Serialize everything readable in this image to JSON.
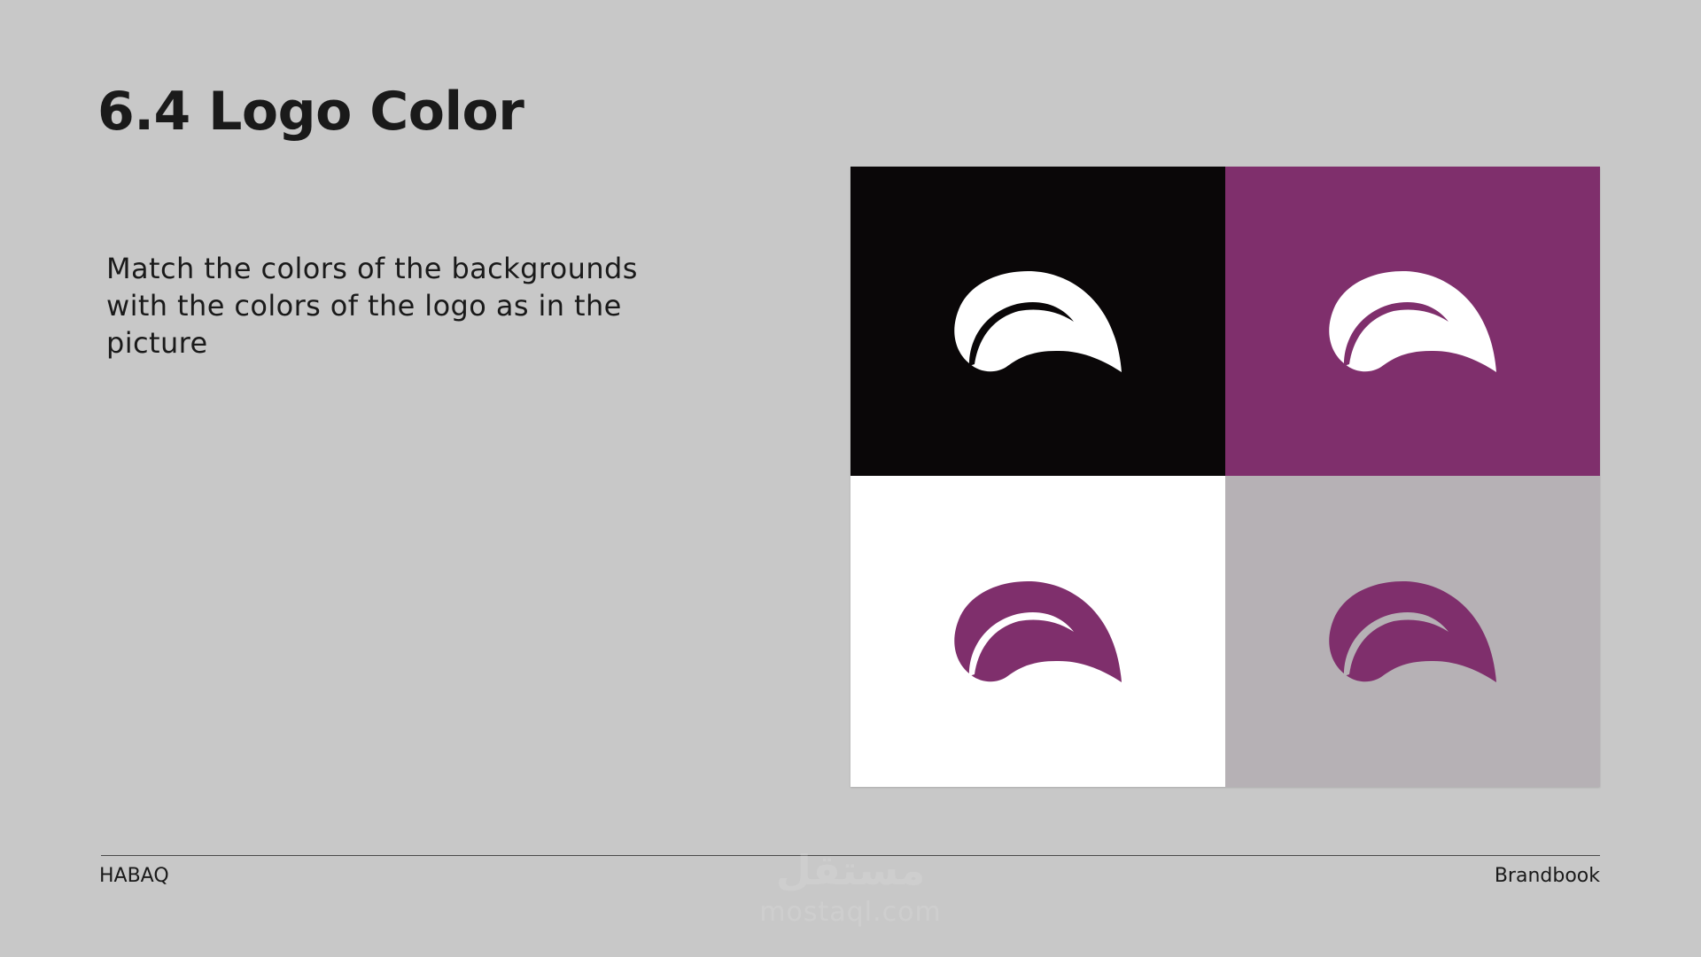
{
  "slide": {
    "title": "6.4 Logo Color",
    "description": "Match the colors of the backgrounds with the colors of the logo as in the picture"
  },
  "logo_variants": [
    {
      "background": "#0a0708",
      "logo_color": "#ffffff",
      "accent_color": "#0a0708"
    },
    {
      "background": "#7f2f6c",
      "logo_color": "#ffffff",
      "accent_color": "#7f2f6c"
    },
    {
      "background": "#ffffff",
      "logo_color": "#7f2f6c",
      "accent_color": "#ffffff"
    },
    {
      "background": "#b6b1b5",
      "logo_color": "#7f2f6c",
      "accent_color": "#b6b1b5"
    }
  ],
  "footer": {
    "left": "HABAQ",
    "right": "Brandbook"
  },
  "watermark": {
    "main": "مستقل",
    "sub": "mostaql.com"
  },
  "colors": {
    "page_background": "#c8c8c8",
    "text": "#1a1a1a",
    "brand_purple": "#7f2f6c"
  }
}
